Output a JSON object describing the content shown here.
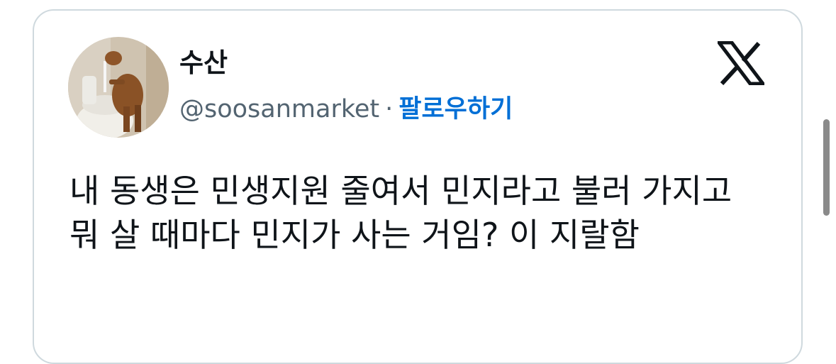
{
  "tweet": {
    "display_name": "수산",
    "handle": "@soosanmarket",
    "separator": "·",
    "follow_label": "팔로우하기",
    "text": "내 동생은 민생지원 줄여서 민지라고 불러 가지고 뭐 살 때마다 민지가 사는 거임? 이 지랄함"
  },
  "icons": {
    "brand": "x-logo-icon",
    "avatar": "avatar-photo"
  },
  "colors": {
    "link": "#006fd6",
    "text": "#0f1419",
    "secondary": "#536471",
    "border": "#cfd9de"
  }
}
